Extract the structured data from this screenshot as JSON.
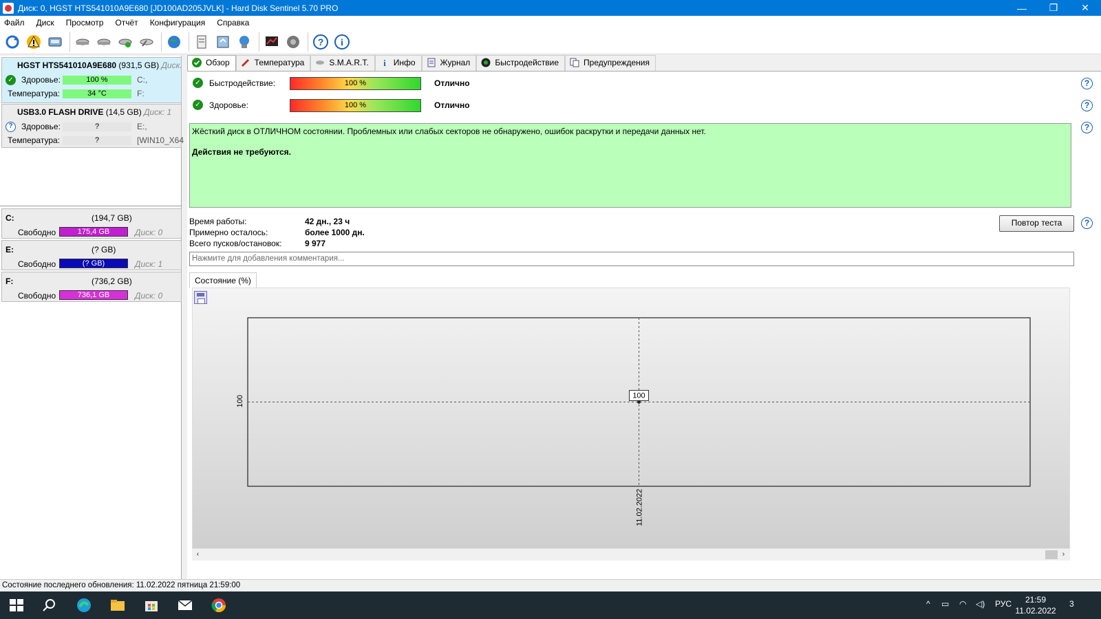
{
  "window": {
    "title": "Диск: 0, HGST HTS541010A9E680 [JD100AD205JVLK]  -  Hard Disk Sentinel 5.70 PRO",
    "minimize": "—",
    "maximize": "❐",
    "close": "✕"
  },
  "menu": [
    "Файл",
    "Диск",
    "Просмотр",
    "Отчёт",
    "Конфигурация",
    "Справка"
  ],
  "disks": [
    {
      "name": "HGST HTS541010A9E680",
      "size": "(931,5 GB)",
      "disk_label": "Диск: 0",
      "health_label": "Здоровье:",
      "health_value": "100 %",
      "health_drive": "C:,",
      "temp_label": "Температура:",
      "temp_value": "34 °C",
      "temp_drive": "F:"
    },
    {
      "name": "USB3.0  FLASH DRIVE",
      "size": "(14,5 GB)",
      "disk_label": "Диск: 1",
      "health_label": "Здоровье:",
      "health_value": "?",
      "health_drive": "E:,",
      "temp_label": "Температура:",
      "temp_value": "?",
      "temp_drive": "[WIN10_X64"
    }
  ],
  "drives": [
    {
      "letter": "C:",
      "size": "(194,7 GB)",
      "free_label": "Свободно",
      "free_value": "175,4 GB",
      "disk": "Диск: 0",
      "color": "#c020d0"
    },
    {
      "letter": "E:",
      "size": "(? GB)",
      "free_label": "Свободно",
      "free_value": "(? GB)",
      "disk": "Диск: 1",
      "color": "#0a0ab8"
    },
    {
      "letter": "F:",
      "size": "(736,2 GB)",
      "free_label": "Свободно",
      "free_value": "736,1 GB",
      "disk": "Диск: 0",
      "color": "#d830d8"
    }
  ],
  "tabs": [
    "Обзор",
    "Температура",
    "S.M.A.R.T.",
    "Инфо",
    "Журнал",
    "Быстродействие",
    "Предупреждения"
  ],
  "metrics": {
    "performance": {
      "label": "Быстродействие:",
      "value": "100 %",
      "rating": "Отлично"
    },
    "health": {
      "label": "Здоровье:",
      "value": "100 %",
      "rating": "Отлично"
    }
  },
  "message": {
    "line1": "Жёсткий диск в ОТЛИЧНОМ состоянии. Проблемных или слабых секторов не обнаружено, ошибок раскрутки и передачи данных нет.",
    "line2": "Действия не требуются."
  },
  "info": [
    {
      "key": "Время работы:",
      "value": "42 дн., 23 ч"
    },
    {
      "key": "Примерно осталось:",
      "value": "более 1000 дн."
    },
    {
      "key": "Всего пусков/остановок:",
      "value": "9 977"
    }
  ],
  "retest_button": "Повтор теста",
  "comment_placeholder": "Нажмите для добавления комментария...",
  "chart_tab": "Состояние (%)",
  "chart_data": {
    "type": "line",
    "x": [
      "11.02.2022"
    ],
    "series": [
      {
        "values": [
          100
        ]
      }
    ],
    "ytick_labels": [
      "100"
    ],
    "point_labels": [
      "100"
    ],
    "grid": true
  },
  "statusbar": "Состояние последнего обновления: 11.02.2022 пятница 21:59:00",
  "taskbar": {
    "lang": "РУС",
    "time": "21:59",
    "date": "11.02.2022",
    "notifications": "3"
  }
}
